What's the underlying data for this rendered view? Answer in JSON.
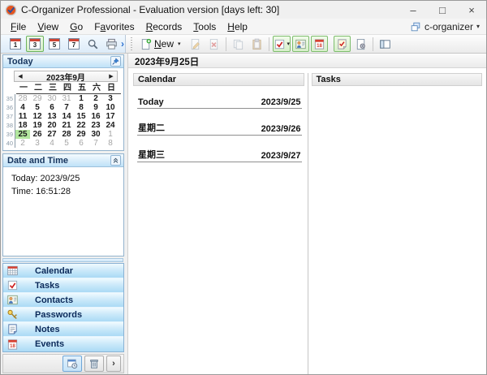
{
  "window": {
    "title": "C-Organizer Professional - Evaluation version [days left: 30]",
    "controls": {
      "minimize": "–",
      "maximize": "□",
      "close": "×"
    }
  },
  "menu": {
    "items": [
      {
        "label": "File",
        "m": 0
      },
      {
        "label": "View",
        "m": 0
      },
      {
        "label": "Go",
        "m": 0
      },
      {
        "label": "Favorites",
        "m": 1
      },
      {
        "label": "Records",
        "m": 0
      },
      {
        "label": "Tools",
        "m": 0
      },
      {
        "label": "Help",
        "m": 0
      }
    ],
    "right_label": "c-organizer",
    "right_caret": "▾"
  },
  "toolbar": {
    "view_buttons": [
      {
        "label": "1",
        "active": false
      },
      {
        "label": "3",
        "active": true
      },
      {
        "label": "5",
        "active": false
      },
      {
        "label": "7",
        "active": false
      }
    ],
    "new_label": "New",
    "new_mnemonic": 0,
    "new_caret": "▾",
    "overflow_glyph": "›"
  },
  "sidebar": {
    "today": {
      "title": "Today",
      "month": "2023年9月",
      "prev_glyph": "◀",
      "next_glyph": "▶",
      "weekdays": [
        "一",
        "二",
        "三",
        "四",
        "五",
        "六",
        "日"
      ],
      "weeks": [
        {
          "num": "35",
          "days": [
            {
              "d": "28",
              "muted": true
            },
            {
              "d": "29",
              "muted": true
            },
            {
              "d": "30",
              "muted": true
            },
            {
              "d": "31",
              "muted": true
            },
            {
              "d": "1"
            },
            {
              "d": "2"
            },
            {
              "d": "3"
            }
          ]
        },
        {
          "num": "36",
          "days": [
            {
              "d": "4"
            },
            {
              "d": "5"
            },
            {
              "d": "6"
            },
            {
              "d": "7"
            },
            {
              "d": "8"
            },
            {
              "d": "9"
            },
            {
              "d": "10"
            }
          ]
        },
        {
          "num": "37",
          "days": [
            {
              "d": "11"
            },
            {
              "d": "12"
            },
            {
              "d": "13"
            },
            {
              "d": "14"
            },
            {
              "d": "15"
            },
            {
              "d": "16"
            },
            {
              "d": "17"
            }
          ]
        },
        {
          "num": "38",
          "days": [
            {
              "d": "18"
            },
            {
              "d": "19"
            },
            {
              "d": "20"
            },
            {
              "d": "21"
            },
            {
              "d": "22"
            },
            {
              "d": "23"
            },
            {
              "d": "24"
            }
          ]
        },
        {
          "num": "39",
          "days": [
            {
              "d": "25",
              "selected": true
            },
            {
              "d": "26"
            },
            {
              "d": "27"
            },
            {
              "d": "28"
            },
            {
              "d": "29"
            },
            {
              "d": "30"
            },
            {
              "d": "1",
              "muted": true
            }
          ]
        },
        {
          "num": "40",
          "days": [
            {
              "d": "2",
              "muted": true
            },
            {
              "d": "3",
              "muted": true
            },
            {
              "d": "4",
              "muted": true
            },
            {
              "d": "5",
              "muted": true
            },
            {
              "d": "6",
              "muted": true
            },
            {
              "d": "7",
              "muted": true
            },
            {
              "d": "8",
              "muted": true
            }
          ]
        }
      ]
    },
    "datetime": {
      "title": "Date and Time",
      "today_line": "Today: 2023/9/25",
      "time_line": "Time: 16:51:28"
    },
    "nav_items": [
      {
        "label": "Calendar",
        "icon": "calendar-nav-icon"
      },
      {
        "label": "Tasks",
        "icon": "tasks-nav-icon"
      },
      {
        "label": "Contacts",
        "icon": "contacts-nav-icon"
      },
      {
        "label": "Passwords",
        "icon": "passwords-nav-icon"
      },
      {
        "label": "Notes",
        "icon": "notes-nav-icon"
      },
      {
        "label": "Events",
        "icon": "events-nav-icon"
      }
    ],
    "footer_overflow_glyph": "›"
  },
  "main": {
    "header": "2023年9月25日",
    "calendar_panel": {
      "title": "Calendar",
      "entries": [
        {
          "label": "Today",
          "date": "2023/9/25"
        },
        {
          "label": "星期二",
          "date": "2023/9/26"
        },
        {
          "label": "星期三",
          "date": "2023/9/27"
        }
      ]
    },
    "tasks_panel": {
      "title": "Tasks",
      "entries": []
    }
  },
  "icons": {
    "app-logo-icon": "check-badge",
    "minimize-icon": "–",
    "maximize-icon": "□",
    "close-icon": "×",
    "windows-cascade-icon": "cascade",
    "search-icon": "magnifier",
    "print-icon": "printer",
    "new-record-icon": "page-plus",
    "edit-record-icon": "page-pencil",
    "delete-record-icon": "page-x",
    "copy-icon": "copy",
    "paste-icon": "clipboard",
    "tasks-toggle-icon": "checkbox-check",
    "contacts-toggle-icon": "person-card",
    "events-toggle-icon": "calendar-red",
    "notes-toggle-icon": "note-check",
    "filter-icon": "page-gear",
    "panels-icon": "panel-layout",
    "pin-icon": "pushpin",
    "collapse-icon": "chevrons-up",
    "calendar-nav-icon": "calendar-grid",
    "tasks-nav-icon": "checkbox-check",
    "contacts-nav-icon": "person-card",
    "passwords-nav-icon": "key",
    "notes-nav-icon": "note-page",
    "events-nav-icon": "calendar-red",
    "planner-view-icon": "calendar-clock",
    "recycle-bin-icon": "trash"
  },
  "colors": {
    "panel_header_blue": "#bfe2f8",
    "nav_bar_blue": "#aadaf5",
    "toggle_green_border": "#7dbd6d",
    "selected_day_green": "#b2e69e",
    "header_text_navy": "#16355e",
    "event_red": "#d84030"
  }
}
